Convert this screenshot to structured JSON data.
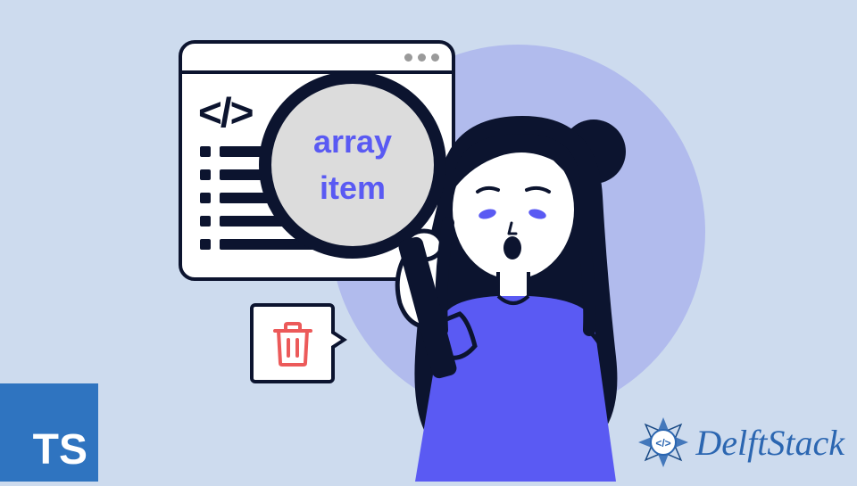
{
  "magnifier": {
    "line1": "array",
    "line2": "item"
  },
  "ts_badge": {
    "label": "TS"
  },
  "brand": {
    "name": "DelftStack"
  }
}
